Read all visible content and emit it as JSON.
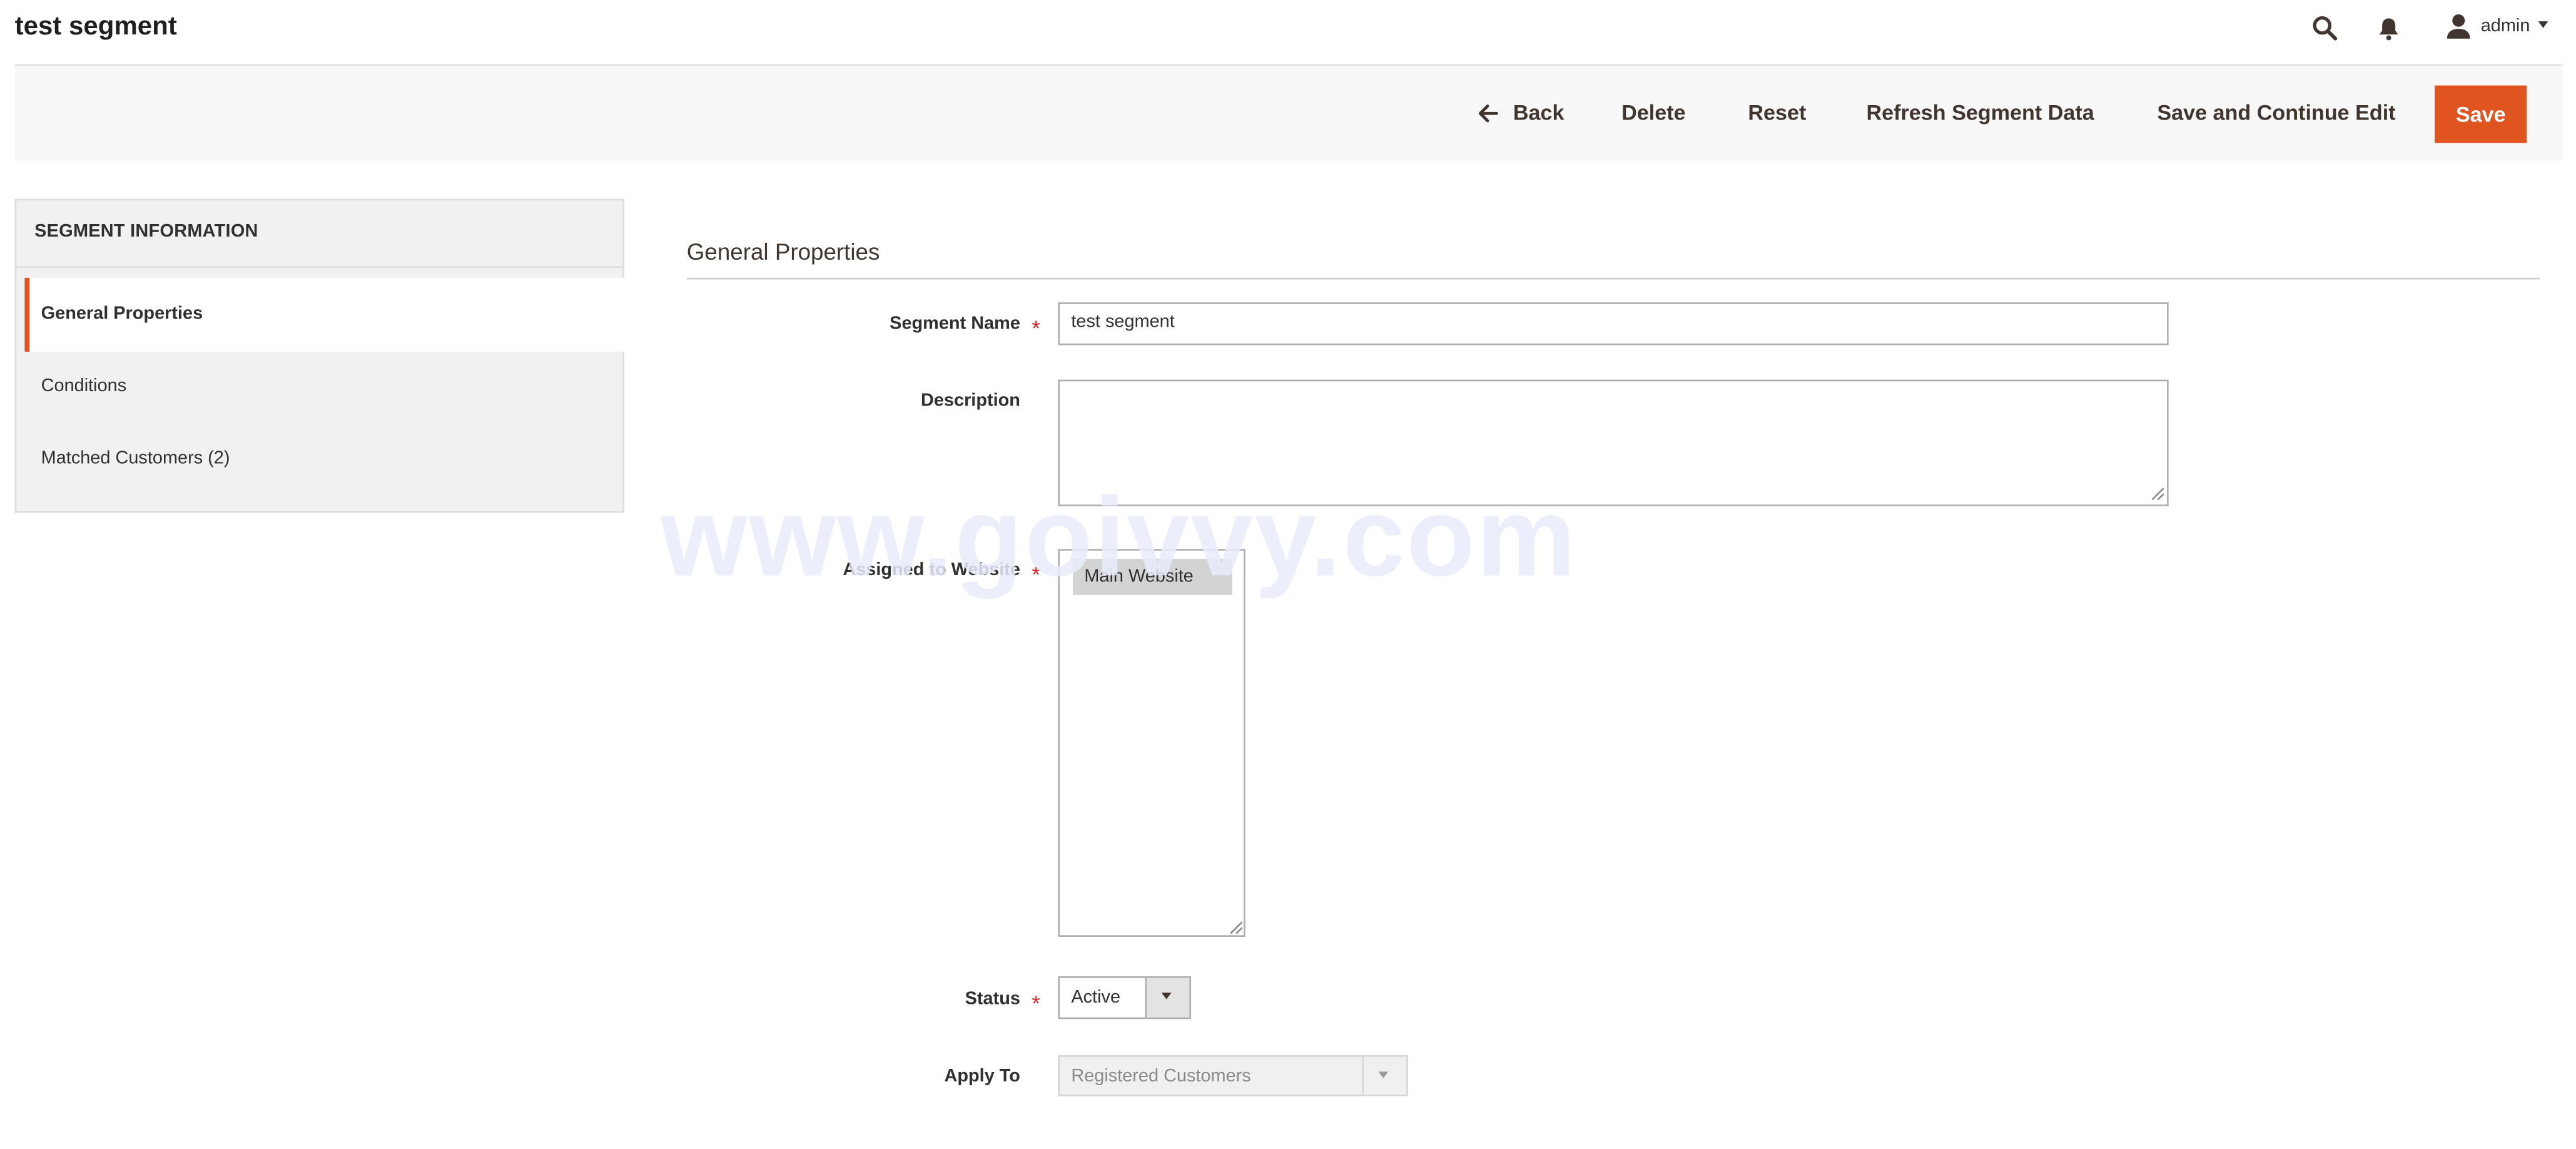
{
  "header": {
    "title": "test segment",
    "user": "admin",
    "icons": [
      "search-icon",
      "bell-icon",
      "user-icon",
      "chevron-down-icon"
    ]
  },
  "toolbar": {
    "back_label": "Back",
    "delete_label": "Delete",
    "reset_label": "Reset",
    "refresh_label": "Refresh Segment Data",
    "save_continue_label": "Save and Continue Edit",
    "save_label": "Save"
  },
  "sidebar": {
    "title": "SEGMENT INFORMATION",
    "items": [
      {
        "label": "General Properties",
        "active": true
      },
      {
        "label": "Conditions",
        "active": false
      },
      {
        "label": "Matched Customers (2)",
        "active": false
      }
    ]
  },
  "form": {
    "section_title": "General Properties",
    "segment_name": {
      "label": "Segment Name",
      "value": "test segment",
      "required": true
    },
    "description": {
      "label": "Description",
      "value": ""
    },
    "website": {
      "label": "Assigned to Website",
      "options": [
        "Main Website"
      ],
      "selected": "Main Website",
      "required": true
    },
    "status": {
      "label": "Status",
      "value": "Active",
      "required": true
    },
    "apply_to": {
      "label": "Apply To",
      "value": "Registered Customers",
      "disabled": true
    }
  },
  "watermark": "www.goivvy.com",
  "colors": {
    "accent": "#e0551f",
    "required": "#e22626"
  }
}
